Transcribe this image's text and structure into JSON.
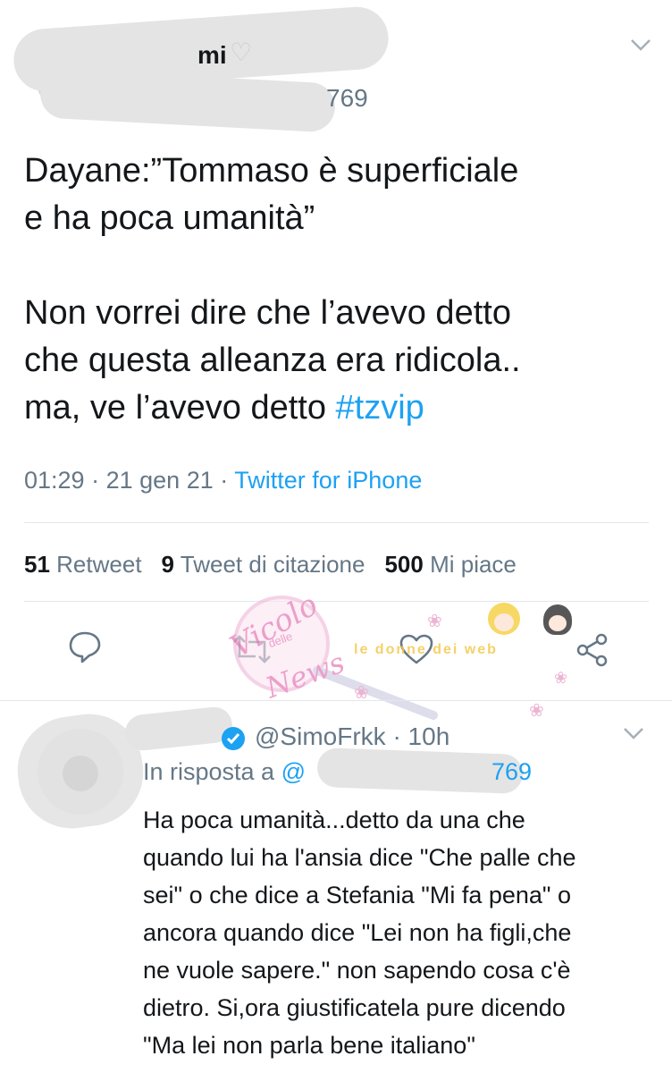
{
  "tweet": {
    "author_name_visible": "mi",
    "handle_visible": "769",
    "text_lines": [
      "Dayane:”Tommaso è superficiale",
      "e ha poca umanità”",
      "Non vorrei dire che l’avevo detto",
      "che questa alleanza era ridicola..",
      "ma, ve l’avevo detto "
    ],
    "hashtag": "#tzvip",
    "time": "01:29",
    "date": "21 gen 21",
    "separator": "·",
    "source": "Twitter for iPhone",
    "stats": {
      "retweets_count": "51",
      "retweets_label": "Retweet",
      "quotes_count": "9",
      "quotes_label": "Tweet di citazione",
      "likes_count": "500",
      "likes_label": "Mi piace"
    }
  },
  "reply": {
    "handle": "@SimoFrkk",
    "separator": "·",
    "time": "10h",
    "reply_to_label": "In risposta a",
    "reply_to_at": "@",
    "reply_to_handle_visible": "769",
    "text_lines": [
      "Ha poca umanità...detto da una che",
      "quando lui ha l'ansia dice \"Che palle che",
      "sei\" o che dice a Stefania \"Mi fa pena\" o",
      "ancora quando dice \"Lei non ha figli,che",
      "ne vuole sapere.\" non sapendo cosa c'è",
      "dietro. Si,ora giustificatela pure dicendo",
      "\"Ma lei non parla bene italiano\""
    ]
  },
  "watermark": {
    "word1": "Vicolo",
    "word2": "delle",
    "word3": "News",
    "banner": "le donne dei web"
  },
  "colors": {
    "link": "#1da1f2",
    "secondary": "#657786",
    "text": "#14171a",
    "divider": "#e1e8ed",
    "verified": "#1da1f2"
  }
}
